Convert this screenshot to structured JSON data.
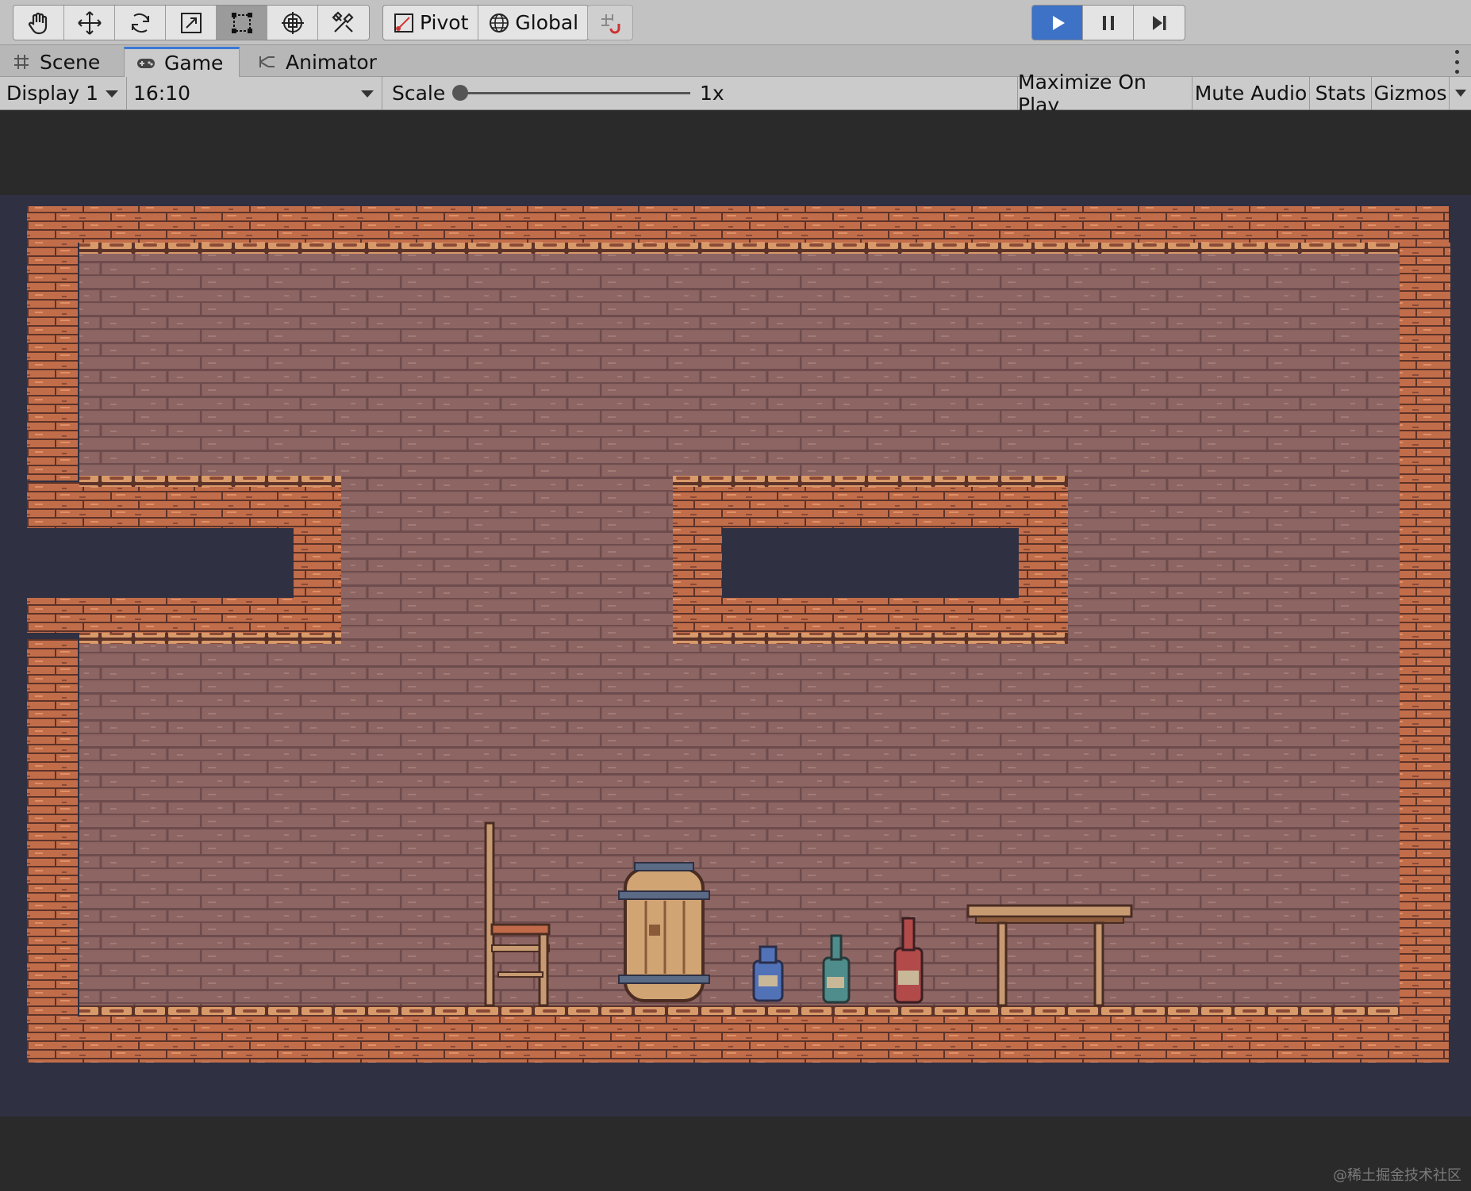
{
  "toolbar": {
    "tools": [
      {
        "name": "hand-tool",
        "icon": "hand-icon",
        "active": false
      },
      {
        "name": "move-tool",
        "icon": "move-arrows-icon",
        "active": false
      },
      {
        "name": "rotate-tool",
        "icon": "rotate-icon",
        "active": false
      },
      {
        "name": "scale-tool",
        "icon": "scale-icon",
        "active": false
      },
      {
        "name": "rect-tool",
        "icon": "rect-transform-icon",
        "active": true
      },
      {
        "name": "transform-tool",
        "icon": "transform-icon",
        "active": false
      },
      {
        "name": "custom-tool",
        "icon": "custom-tools-icon",
        "active": false
      }
    ],
    "pivot_label": "Pivot",
    "global_label": "Global",
    "snap_icon": "grid-snap-icon",
    "play_state": "playing"
  },
  "tabs": [
    {
      "label": "Scene",
      "icon": "grid-hash-icon",
      "active": false
    },
    {
      "label": "Game",
      "icon": "gamepad-icon",
      "active": true
    },
    {
      "label": "Animator",
      "icon": "animator-icon",
      "active": false
    }
  ],
  "game_toolbar": {
    "display": "Display 1",
    "aspect": "16:10",
    "scale_label": "Scale",
    "scale_value": "1x",
    "scale_level": 0,
    "maximize_label": "Maximize On Play",
    "mute_label": "Mute Audio",
    "stats_label": "Stats",
    "gizmos_label": "Gizmos"
  },
  "colors": {
    "accent": "#3d72c7",
    "tab_active_line": "#3a79d8",
    "game_bg": "#2f3042",
    "brick": "#c26d4a",
    "brick_dark": "#8a4a36",
    "wall": "#8a6361",
    "wall_line": "#6e4c4d"
  },
  "watermark": "@稀土掘金技术社区"
}
